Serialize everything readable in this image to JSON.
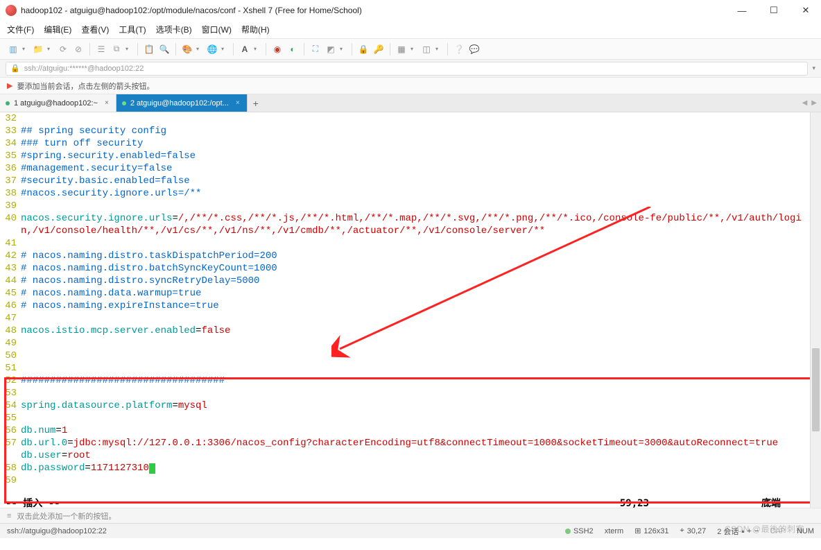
{
  "window": {
    "title": "hadoop102 - atguigu@hadoop102:/opt/module/nacos/conf - Xshell 7 (Free for Home/School)"
  },
  "menu": {
    "file": "文件(F)",
    "edit": "编辑(E)",
    "view": "查看(V)",
    "tools": "工具(T)",
    "tabs": "选项卡(B)",
    "window": "窗口(W)",
    "help": "帮助(H)"
  },
  "address": {
    "text": "ssh://atguigu:******@hadoop102:22"
  },
  "hint": {
    "text": "要添加当前会话，点击左侧的箭头按钮。"
  },
  "tabs": {
    "tab1": "1 atguigu@hadoop102:~",
    "tab2": "2 atguigu@hadoop102:/opt...",
    "add": "+"
  },
  "code": {
    "lines": [
      {
        "n": "32",
        "parts": []
      },
      {
        "n": "33",
        "parts": [
          {
            "c": "c-blue",
            "t": "## spring security config"
          }
        ]
      },
      {
        "n": "34",
        "parts": [
          {
            "c": "c-blue",
            "t": "### turn off security"
          }
        ]
      },
      {
        "n": "35",
        "parts": [
          {
            "c": "c-blue",
            "t": "#spring.security.enabled=false"
          }
        ]
      },
      {
        "n": "36",
        "parts": [
          {
            "c": "c-blue",
            "t": "#management.security=false"
          }
        ]
      },
      {
        "n": "37",
        "parts": [
          {
            "c": "c-blue",
            "t": "#security.basic.enabled=false"
          }
        ]
      },
      {
        "n": "38",
        "parts": [
          {
            "c": "c-blue",
            "t": "#nacos.security.ignore.urls=/**"
          }
        ]
      },
      {
        "n": "39",
        "parts": []
      },
      {
        "n": "40",
        "parts": [
          {
            "c": "c-teal",
            "t": "nacos.security.ignore.urls"
          },
          {
            "c": "c-black",
            "t": "="
          },
          {
            "c": "c-red",
            "t": "/,/**/*.css,/**/*.js,/**/*.html,/**/*.map,/**/*.svg,/**/*.png,/**/*.ico,/console-fe/public/**,/v1/auth/login,/v1/console/health/**,/v1/cs/**,/v1/ns/**,/v1/cmdb/**,/actuator/**,/v1/console/server/**"
          }
        ]
      },
      {
        "n": "41",
        "parts": []
      },
      {
        "n": "42",
        "parts": [
          {
            "c": "c-blue",
            "t": "# nacos.naming.distro.taskDispatchPeriod=200"
          }
        ]
      },
      {
        "n": "43",
        "parts": [
          {
            "c": "c-blue",
            "t": "# nacos.naming.distro.batchSyncKeyCount=1000"
          }
        ]
      },
      {
        "n": "44",
        "parts": [
          {
            "c": "c-blue",
            "t": "# nacos.naming.distro.syncRetryDelay=5000"
          }
        ]
      },
      {
        "n": "45",
        "parts": [
          {
            "c": "c-blue",
            "t": "# nacos.naming.data.warmup=true"
          }
        ]
      },
      {
        "n": "46",
        "parts": [
          {
            "c": "c-blue",
            "t": "# nacos.naming.expireInstance=true"
          }
        ]
      },
      {
        "n": "47",
        "parts": []
      },
      {
        "n": "48",
        "parts": [
          {
            "c": "c-teal",
            "t": "nacos.istio.mcp.server.enabled"
          },
          {
            "c": "c-black",
            "t": "="
          },
          {
            "c": "c-red",
            "t": "false"
          }
        ]
      },
      {
        "n": "49",
        "parts": []
      },
      {
        "n": "50",
        "parts": []
      },
      {
        "n": "51",
        "parts": []
      },
      {
        "n": "52",
        "parts": [
          {
            "c": "c-blue",
            "t": "###################################"
          }
        ]
      },
      {
        "n": "53",
        "parts": []
      },
      {
        "n": "54",
        "parts": [
          {
            "c": "c-teal",
            "t": "spring.datasource.platform"
          },
          {
            "c": "c-black",
            "t": "="
          },
          {
            "c": "c-red",
            "t": "mysql"
          }
        ]
      },
      {
        "n": "55",
        "parts": []
      },
      {
        "n": "56",
        "parts": [
          {
            "c": "c-teal",
            "t": "db.num"
          },
          {
            "c": "c-black",
            "t": "="
          },
          {
            "c": "c-red",
            "t": "1"
          }
        ]
      },
      {
        "n": "57",
        "parts": [
          {
            "c": "c-teal",
            "t": "db.url.0"
          },
          {
            "c": "c-black",
            "t": "="
          },
          {
            "c": "c-red",
            "t": "jdbc:mysql://127.0.0.1:3306/nacos_config?characterEncoding=utf8&connectTimeout=1000&socketTimeout=3000&autoReconnect=true"
          }
        ]
      },
      {
        "n": "58",
        "parts": [
          {
            "c": "c-teal",
            "t": "db.user"
          },
          {
            "c": "c-black",
            "t": "="
          },
          {
            "c": "c-red",
            "t": "root"
          }
        ]
      },
      {
        "n": "59",
        "parts": [
          {
            "c": "c-teal",
            "t": "db.password"
          },
          {
            "c": "c-black",
            "t": "="
          },
          {
            "c": "c-red",
            "t": "1171127310"
          }
        ],
        "cursor": true
      }
    ]
  },
  "vim": {
    "mode": "-- 插入 --",
    "pos": "59,23",
    "loc": "底端"
  },
  "hint2": {
    "text": "双击此处添加一个新的按钮。"
  },
  "status": {
    "path": "ssh://atguigu@hadoop102:22",
    "proto": "SSH2",
    "term": "xterm",
    "size": "126x31",
    "cursor": "30,27",
    "sessions": "2 会话",
    "cap": "CAP",
    "num": "NUM"
  },
  "watermark": "CSDN @最後的刺客"
}
